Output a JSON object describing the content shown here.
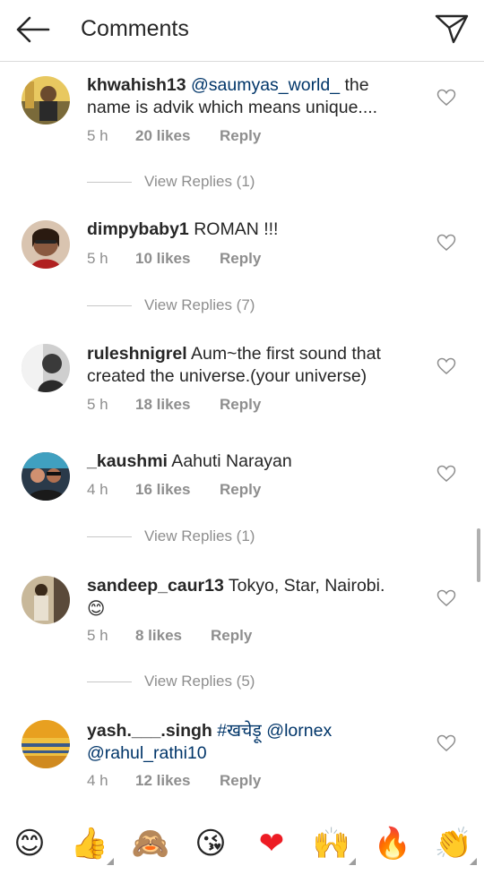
{
  "header": {
    "title": "Comments",
    "back_icon": "arrow-left-icon",
    "share_icon": "paper-plane-icon"
  },
  "comments": [
    {
      "username": "khwahish13",
      "mention": "@saumyas_world_",
      "text": " the name is advik which means unique....",
      "time": "5 h",
      "likes": "20 likes",
      "reply": "Reply",
      "view_replies": "View Replies (1)"
    },
    {
      "username": "dimpybaby1",
      "text": " ROMAN !!!",
      "time": "5 h",
      "likes": "10 likes",
      "reply": "Reply",
      "view_replies": "View Replies (7)"
    },
    {
      "username": "ruleshnigrel",
      "text": " Aum~the first sound that created the universe.(your universe)",
      "time": "5 h",
      "likes": "18 likes",
      "reply": "Reply"
    },
    {
      "username": "_kaushmi",
      "text": " Aahuti Narayan",
      "time": "4 h",
      "likes": "16 likes",
      "reply": "Reply",
      "view_replies": "View Replies (1)"
    },
    {
      "username": "sandeep_caur13",
      "text": " Tokyo, Star, Nairobi.",
      "emoji": "😊",
      "time": "5 h",
      "likes": "8 likes",
      "reply": "Reply",
      "view_replies": "View Replies (5)"
    },
    {
      "username": "yash.___.singh",
      "hashtag": "#खचेड़ू",
      "mention1": "@lornex",
      "mention2": "@rahul_rathi10",
      "time": "4 h",
      "likes": "12 likes",
      "reply": "Reply"
    }
  ],
  "emoji_bar": [
    "😊",
    "👍",
    "🙈",
    "😘",
    "❤",
    "🙌",
    "🔥",
    "👏"
  ],
  "colors": {
    "text": "#262626",
    "muted": "#8e8e8e",
    "link": "#003569",
    "heart_red": "#ed1c24"
  }
}
